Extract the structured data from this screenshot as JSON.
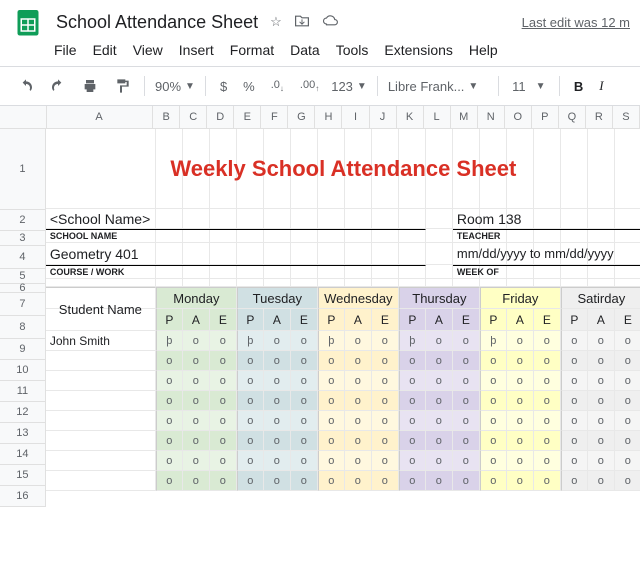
{
  "doc": {
    "title": "School Attendance Sheet",
    "lastedit": "Last edit was 12 m"
  },
  "menu": {
    "file": "File",
    "edit": "Edit",
    "view": "View",
    "insert": "Insert",
    "format": "Format",
    "data": "Data",
    "tools": "Tools",
    "extensions": "Extensions",
    "help": "Help"
  },
  "toolbar": {
    "zoom": "90%",
    "dollar": "$",
    "percent": "%",
    "dec0": ".0",
    "dec00": ".00",
    "num": "123",
    "font": "Libre Frank...",
    "fontsize": "11",
    "bold": "B"
  },
  "cols": [
    "A",
    "B",
    "C",
    "D",
    "E",
    "F",
    "G",
    "H",
    "I",
    "J",
    "K",
    "L",
    "M",
    "N",
    "O",
    "P",
    "Q",
    "R",
    "S"
  ],
  "rows": [
    "1",
    "2",
    "3",
    "4",
    "5",
    "6",
    "7",
    "8",
    "9",
    "10",
    "11",
    "12",
    "13",
    "14",
    "15",
    "16"
  ],
  "sheet": {
    "title": "Weekly School Attendance Sheet",
    "school": "<School Name>",
    "school_label": "SCHOOL NAME",
    "room": "Room 138",
    "teacher_label": "TEACHER",
    "course": "Geometry 401",
    "course_label": "COURSE / WORK",
    "week": "mm/dd/yyyy to mm/dd/yyyy",
    "week_label": "WEEK OF",
    "student_hdr": "Student Name",
    "days": [
      "Monday",
      "Tuesday",
      "Wednesday",
      "Thursday",
      "Friday",
      "Satirday"
    ],
    "pae": [
      "P",
      "A",
      "E"
    ],
    "student1": "John Smith",
    "mark_p": "þ",
    "mark_o": "o"
  },
  "chart_data": {
    "type": "table",
    "title": "Weekly School Attendance Sheet",
    "columns": [
      "Student Name",
      "Mon P",
      "Mon A",
      "Mon E",
      "Tue P",
      "Tue A",
      "Tue E",
      "Wed P",
      "Wed A",
      "Wed E",
      "Thu P",
      "Thu A",
      "Thu E",
      "Fri P",
      "Fri A",
      "Fri E",
      "Sat P",
      "Sat A",
      "Sat E"
    ],
    "rows": [
      [
        "John Smith",
        "þ",
        "o",
        "o",
        "þ",
        "o",
        "o",
        "þ",
        "o",
        "o",
        "þ",
        "o",
        "o",
        "þ",
        "o",
        "o",
        "o",
        "o",
        "o"
      ],
      [
        "",
        "o",
        "o",
        "o",
        "o",
        "o",
        "o",
        "o",
        "o",
        "o",
        "o",
        "o",
        "o",
        "o",
        "o",
        "o",
        "o",
        "o",
        "o"
      ],
      [
        "",
        "o",
        "o",
        "o",
        "o",
        "o",
        "o",
        "o",
        "o",
        "o",
        "o",
        "o",
        "o",
        "o",
        "o",
        "o",
        "o",
        "o",
        "o"
      ],
      [
        "",
        "o",
        "o",
        "o",
        "o",
        "o",
        "o",
        "o",
        "o",
        "o",
        "o",
        "o",
        "o",
        "o",
        "o",
        "o",
        "o",
        "o",
        "o"
      ],
      [
        "",
        "o",
        "o",
        "o",
        "o",
        "o",
        "o",
        "o",
        "o",
        "o",
        "o",
        "o",
        "o",
        "o",
        "o",
        "o",
        "o",
        "o",
        "o"
      ],
      [
        "",
        "o",
        "o",
        "o",
        "o",
        "o",
        "o",
        "o",
        "o",
        "o",
        "o",
        "o",
        "o",
        "o",
        "o",
        "o",
        "o",
        "o",
        "o"
      ],
      [
        "",
        "o",
        "o",
        "o",
        "o",
        "o",
        "o",
        "o",
        "o",
        "o",
        "o",
        "o",
        "o",
        "o",
        "o",
        "o",
        "o",
        "o",
        "o"
      ],
      [
        "",
        "o",
        "o",
        "o",
        "o",
        "o",
        "o",
        "o",
        "o",
        "o",
        "o",
        "o",
        "o",
        "o",
        "o",
        "o",
        "o",
        "o",
        "o"
      ]
    ]
  }
}
